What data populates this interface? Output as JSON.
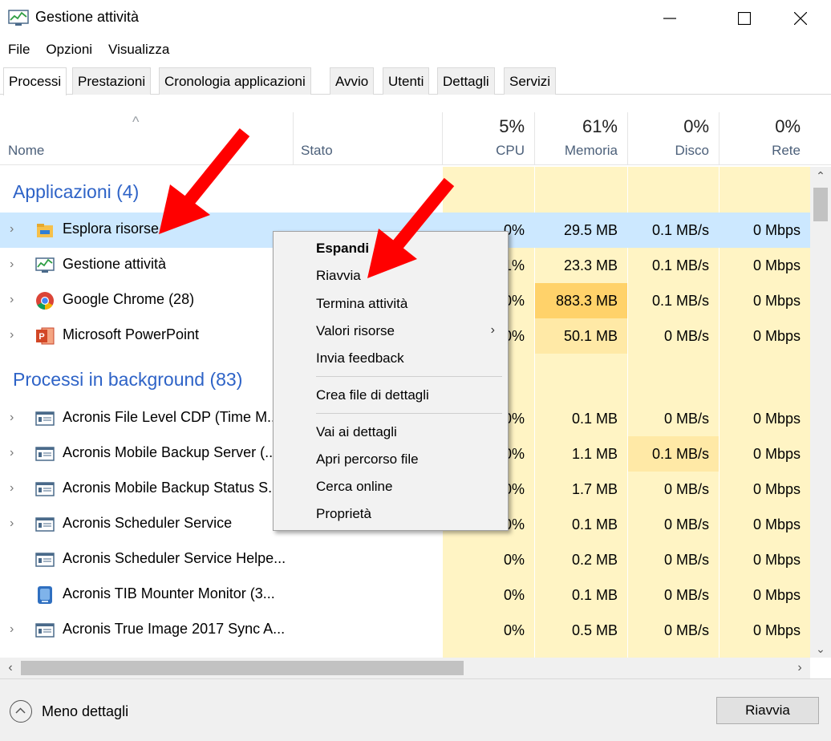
{
  "window": {
    "title": "Gestione attività",
    "controls": [
      "minimize",
      "maximize",
      "close"
    ]
  },
  "menu": [
    "File",
    "Opzioni",
    "Visualizza"
  ],
  "tabs": [
    {
      "label": "Processi",
      "active": true
    },
    {
      "label": "Prestazioni",
      "active": false
    },
    {
      "label": "Cronologia applicazioni",
      "active": false
    },
    {
      "label": "Avvio",
      "active": false
    },
    {
      "label": "Utenti",
      "active": false
    },
    {
      "label": "Dettagli",
      "active": false
    },
    {
      "label": "Servizi",
      "active": false
    }
  ],
  "columns": {
    "name": "Nome",
    "status": "Stato",
    "cpu": {
      "percent": "5%",
      "label": "CPU"
    },
    "memory": {
      "percent": "61%",
      "label": "Memoria"
    },
    "disk": {
      "percent": "0%",
      "label": "Disco"
    },
    "network": {
      "percent": "0%",
      "label": "Rete"
    }
  },
  "groups": {
    "apps": "Applicazioni (4)",
    "background": "Processi in background (83)"
  },
  "apps": [
    {
      "name": "Esplora risorse",
      "cpu": "0%",
      "mem": "29.5 MB",
      "disk": "0.1 MB/s",
      "net": "0 Mbps",
      "icon": "folder-icon"
    },
    {
      "name": "Gestione attività",
      "cpu": "1%",
      "mem": "23.3 MB",
      "disk": "0.1 MB/s",
      "net": "0 Mbps",
      "icon": "task-manager-icon"
    },
    {
      "name": "Google Chrome (28)",
      "cpu": "0%",
      "mem": "883.3 MB",
      "disk": "0.1 MB/s",
      "net": "0 Mbps",
      "icon": "chrome-icon"
    },
    {
      "name": "Microsoft PowerPoint",
      "cpu": "0%",
      "mem": "50.1 MB",
      "disk": "0 MB/s",
      "net": "0 Mbps",
      "icon": "powerpoint-icon"
    }
  ],
  "background": [
    {
      "name": "Acronis File Level CDP (Time M...",
      "cpu": "0%",
      "mem": "0.1 MB",
      "disk": "0 MB/s",
      "net": "0 Mbps",
      "icon": "service-icon"
    },
    {
      "name": "Acronis Mobile Backup Server (...",
      "cpu": "0%",
      "mem": "1.1 MB",
      "disk": "0.1 MB/s",
      "net": "0 Mbps",
      "icon": "service-icon"
    },
    {
      "name": "Acronis Mobile Backup Status S...",
      "cpu": "0%",
      "mem": "1.7 MB",
      "disk": "0 MB/s",
      "net": "0 Mbps",
      "icon": "service-icon"
    },
    {
      "name": "Acronis Scheduler Service",
      "cpu": "0%",
      "mem": "0.1 MB",
      "disk": "0 MB/s",
      "net": "0 Mbps",
      "icon": "service-icon"
    },
    {
      "name": "Acronis Scheduler Service Helpe...",
      "cpu": "0%",
      "mem": "0.2 MB",
      "disk": "0 MB/s",
      "net": "0 Mbps",
      "icon": "service-icon"
    },
    {
      "name": "Acronis TIB Mounter Monitor (3...",
      "cpu": "0%",
      "mem": "0.1 MB",
      "disk": "0 MB/s",
      "net": "0 Mbps",
      "icon": "disk-icon"
    },
    {
      "name": "Acronis True Image 2017 Sync A...",
      "cpu": "0%",
      "mem": "0.5 MB",
      "disk": "0 MB/s",
      "net": "0 Mbps",
      "icon": "service-icon"
    }
  ],
  "context_menu": {
    "items": [
      {
        "label": "Espandi",
        "bold": true
      },
      {
        "label": "Riavvia"
      },
      {
        "label": "Termina attività"
      },
      {
        "label": "Valori risorse",
        "submenu": true
      },
      {
        "label": "Invia feedback"
      },
      {
        "label": "Crea file di dettagli"
      },
      {
        "label": "Vai ai dettagli"
      },
      {
        "label": "Apri percorso file"
      },
      {
        "label": "Cerca online"
      },
      {
        "label": "Proprietà"
      }
    ]
  },
  "footer": {
    "less_details": "Meno dettagli",
    "restart_button": "Riavvia"
  },
  "colors": {
    "accent": "#2e63c7",
    "selection": "#cce8ff",
    "heat_low": "#fff4c4",
    "heat_mid": "#ffe9a6",
    "heat_high": "#ffd26a",
    "annotation_arrow": "#ff0000"
  }
}
